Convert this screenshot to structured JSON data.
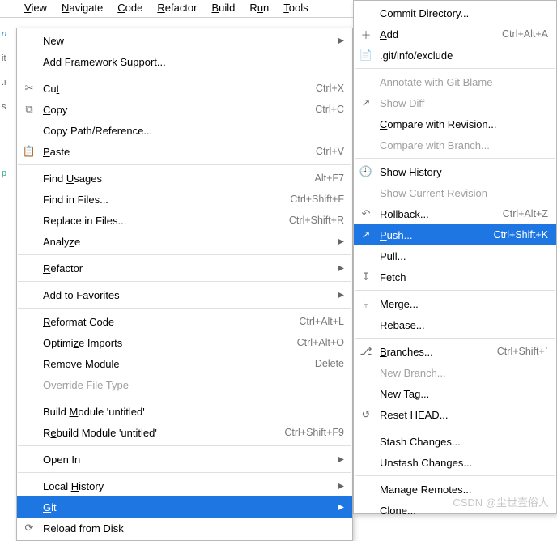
{
  "menubar": [
    {
      "pre": "",
      "mn": "V",
      "post": "iew"
    },
    {
      "pre": "",
      "mn": "N",
      "post": "avigate"
    },
    {
      "pre": "",
      "mn": "C",
      "post": "ode"
    },
    {
      "pre": "",
      "mn": "R",
      "post": "efactor"
    },
    {
      "pre": "",
      "mn": "B",
      "post": "uild"
    },
    {
      "pre": "R",
      "mn": "u",
      "post": "n"
    },
    {
      "pre": "",
      "mn": "T",
      "post": "ools"
    }
  ],
  "main_menu": [
    {
      "type": "item",
      "icon": "",
      "label": "New",
      "shortcut": "",
      "arrow": true
    },
    {
      "type": "item",
      "icon": "",
      "label": "Add Framework Support...",
      "shortcut": "",
      "arrow": false
    },
    {
      "type": "sep"
    },
    {
      "type": "item",
      "icon": "cut",
      "pre": "Cu",
      "mn": "t",
      "post": "",
      "shortcut": "Ctrl+X",
      "arrow": false
    },
    {
      "type": "item",
      "icon": "copy",
      "pre": "",
      "mn": "C",
      "post": "opy",
      "shortcut": "Ctrl+C",
      "arrow": false
    },
    {
      "type": "item",
      "icon": "",
      "label": "Copy Path/Reference...",
      "shortcut": "",
      "arrow": false
    },
    {
      "type": "item",
      "icon": "paste",
      "pre": "",
      "mn": "P",
      "post": "aste",
      "shortcut": "Ctrl+V",
      "arrow": false
    },
    {
      "type": "sep"
    },
    {
      "type": "item",
      "icon": "",
      "pre": "Find ",
      "mn": "U",
      "post": "sages",
      "shortcut": "Alt+F7",
      "arrow": false
    },
    {
      "type": "item",
      "icon": "",
      "label": "Find in Files...",
      "shortcut": "Ctrl+Shift+F",
      "arrow": false
    },
    {
      "type": "item",
      "icon": "",
      "label": "Replace in Files...",
      "shortcut": "Ctrl+Shift+R",
      "arrow": false
    },
    {
      "type": "item",
      "icon": "",
      "pre": "Analy",
      "mn": "z",
      "post": "e",
      "shortcut": "",
      "arrow": true
    },
    {
      "type": "sep"
    },
    {
      "type": "item",
      "icon": "",
      "pre": "",
      "mn": "R",
      "post": "efactor",
      "shortcut": "",
      "arrow": true
    },
    {
      "type": "sep"
    },
    {
      "type": "item",
      "icon": "",
      "pre": "Add to F",
      "mn": "a",
      "post": "vorites",
      "shortcut": "",
      "arrow": true
    },
    {
      "type": "sep"
    },
    {
      "type": "item",
      "icon": "",
      "pre": "",
      "mn": "R",
      "post": "eformat Code",
      "shortcut": "Ctrl+Alt+L",
      "arrow": false
    },
    {
      "type": "item",
      "icon": "",
      "pre": "Optimi",
      "mn": "z",
      "post": "e Imports",
      "shortcut": "Ctrl+Alt+O",
      "arrow": false
    },
    {
      "type": "item",
      "icon": "",
      "label": "Remove Module",
      "shortcut": "Delete",
      "arrow": false
    },
    {
      "type": "item",
      "icon": "",
      "label": "Override File Type",
      "shortcut": "",
      "arrow": false,
      "disabled": true
    },
    {
      "type": "sep"
    },
    {
      "type": "item",
      "icon": "",
      "pre": "Build ",
      "mn": "M",
      "post": "odule 'untitled'",
      "shortcut": "",
      "arrow": false
    },
    {
      "type": "item",
      "icon": "",
      "pre": "R",
      "mn": "e",
      "post": "build Module 'untitled'",
      "shortcut": "Ctrl+Shift+F9",
      "arrow": false
    },
    {
      "type": "sep"
    },
    {
      "type": "item",
      "icon": "",
      "label": "Open In",
      "shortcut": "",
      "arrow": true
    },
    {
      "type": "sep"
    },
    {
      "type": "item",
      "icon": "",
      "pre": "Local ",
      "mn": "H",
      "post": "istory",
      "shortcut": "",
      "arrow": true
    },
    {
      "type": "item",
      "icon": "",
      "pre": "",
      "mn": "G",
      "post": "it",
      "shortcut": "",
      "arrow": true,
      "selected": true
    },
    {
      "type": "item",
      "icon": "reload",
      "label": "Reload from Disk",
      "shortcut": "",
      "arrow": false
    }
  ],
  "sub_menu": [
    {
      "type": "item",
      "icon": "",
      "label": "Commit Directory...",
      "shortcut": "",
      "arrow": false
    },
    {
      "type": "item",
      "icon": "plus",
      "pre": "",
      "mn": "A",
      "post": "dd",
      "shortcut": "Ctrl+Alt+A",
      "arrow": false
    },
    {
      "type": "item",
      "icon": "file",
      "label": ".git/info/exclude",
      "shortcut": "",
      "arrow": false
    },
    {
      "type": "sep"
    },
    {
      "type": "item",
      "icon": "",
      "label": "Annotate with Git Blame",
      "shortcut": "",
      "arrow": false,
      "disabled": true
    },
    {
      "type": "item",
      "icon": "diff",
      "label": "Show Diff",
      "shortcut": "",
      "arrow": false,
      "disabled": true
    },
    {
      "type": "item",
      "icon": "",
      "pre": "",
      "mn": "C",
      "post": "ompare with Revision...",
      "shortcut": "",
      "arrow": false
    },
    {
      "type": "item",
      "icon": "",
      "label": "Compare with Branch...",
      "shortcut": "",
      "arrow": false,
      "disabled": true
    },
    {
      "type": "sep"
    },
    {
      "type": "item",
      "icon": "history",
      "pre": "Show ",
      "mn": "H",
      "post": "istory",
      "shortcut": "",
      "arrow": false
    },
    {
      "type": "item",
      "icon": "",
      "label": "Show Current Revision",
      "shortcut": "",
      "arrow": false,
      "disabled": true
    },
    {
      "type": "item",
      "icon": "rollback",
      "pre": "",
      "mn": "R",
      "post": "ollback...",
      "shortcut": "Ctrl+Alt+Z",
      "arrow": false
    },
    {
      "type": "item",
      "icon": "push",
      "pre": "",
      "mn": "P",
      "post": "ush...",
      "shortcut": "Ctrl+Shift+K",
      "arrow": false,
      "selected": true
    },
    {
      "type": "item",
      "icon": "",
      "label": "Pull...",
      "shortcut": "",
      "arrow": false
    },
    {
      "type": "item",
      "icon": "fetch",
      "label": "Fetch",
      "shortcut": "",
      "arrow": false
    },
    {
      "type": "sep"
    },
    {
      "type": "item",
      "icon": "merge",
      "pre": "",
      "mn": "M",
      "post": "erge...",
      "shortcut": "",
      "arrow": false
    },
    {
      "type": "item",
      "icon": "",
      "label": "Rebase...",
      "shortcut": "",
      "arrow": false
    },
    {
      "type": "sep"
    },
    {
      "type": "item",
      "icon": "branch",
      "pre": "",
      "mn": "B",
      "post": "ranches...",
      "shortcut": "Ctrl+Shift+`",
      "arrow": false
    },
    {
      "type": "item",
      "icon": "",
      "label": "New Branch...",
      "shortcut": "",
      "arrow": false,
      "disabled": true
    },
    {
      "type": "item",
      "icon": "",
      "label": "New Tag...",
      "shortcut": "",
      "arrow": false
    },
    {
      "type": "item",
      "icon": "reset",
      "label": "Reset HEAD...",
      "shortcut": "",
      "arrow": false
    },
    {
      "type": "sep"
    },
    {
      "type": "item",
      "icon": "",
      "label": "Stash Changes...",
      "shortcut": "",
      "arrow": false
    },
    {
      "type": "item",
      "icon": "",
      "label": "Unstash Changes...",
      "shortcut": "",
      "arrow": false
    },
    {
      "type": "sep"
    },
    {
      "type": "item",
      "icon": "",
      "label": "Manage Remotes...",
      "shortcut": "",
      "arrow": false
    },
    {
      "type": "item",
      "icon": "",
      "label": "Clone...",
      "shortcut": "",
      "arrow": false
    }
  ],
  "watermark": "CSDN @尘世壹俗人"
}
